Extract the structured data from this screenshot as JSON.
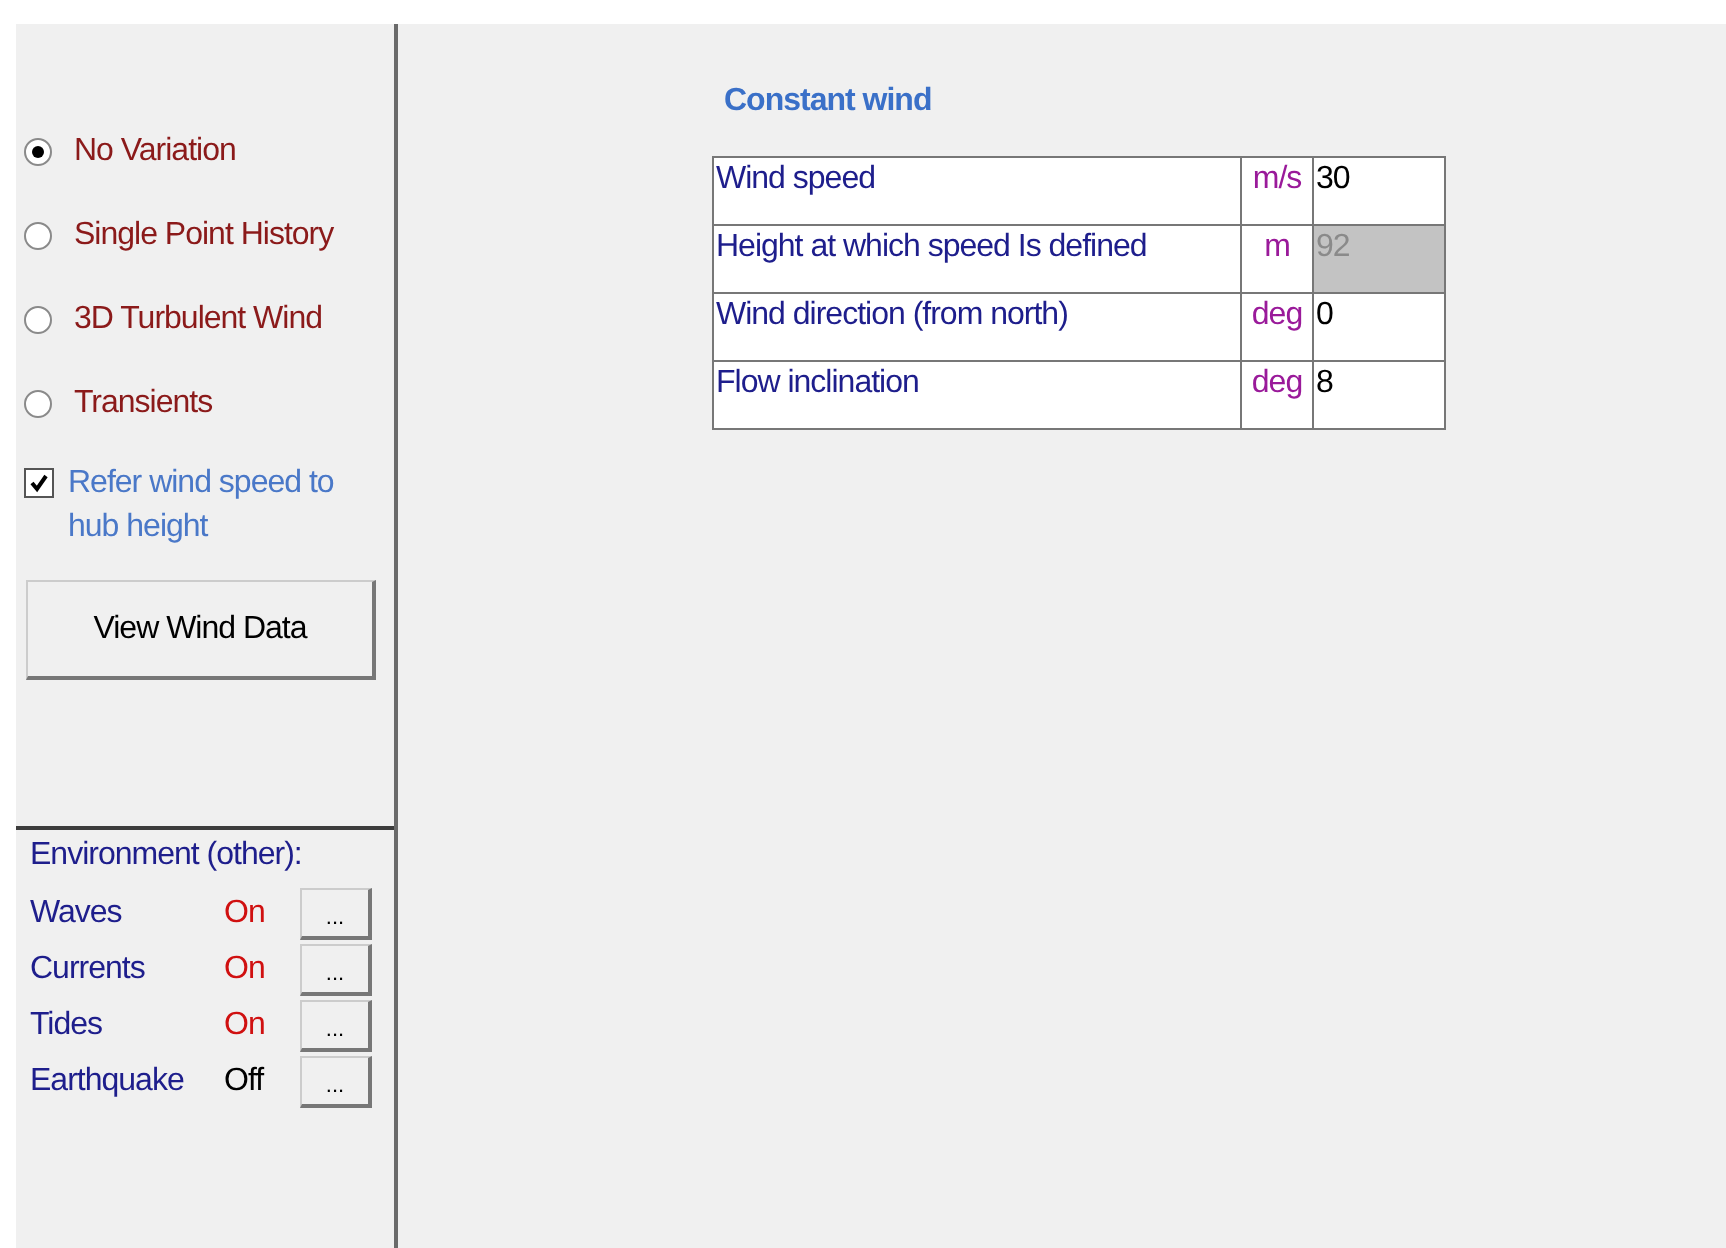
{
  "wind_types": [
    {
      "label": "No Variation",
      "selected": true
    },
    {
      "label": "Single Point History",
      "selected": false
    },
    {
      "label": "3D Turbulent Wind",
      "selected": false
    },
    {
      "label": "Transients",
      "selected": false
    }
  ],
  "refer_hub": {
    "label": "Refer wind speed to hub height",
    "checked": true
  },
  "view_button": "View Wind Data",
  "environment": {
    "title": "Environment (other):",
    "items": [
      {
        "name": "Waves",
        "status": "On",
        "on": true,
        "button": "..."
      },
      {
        "name": "Currents",
        "status": "On",
        "on": true,
        "button": "..."
      },
      {
        "name": "Tides",
        "status": "On",
        "on": true,
        "button": "..."
      },
      {
        "name": "Earthquake",
        "status": "Off",
        "on": false,
        "button": "..."
      }
    ]
  },
  "constant_wind": {
    "title": "Constant wind",
    "rows": [
      {
        "label": "Wind speed",
        "unit": "m/s",
        "value": "30",
        "disabled": false
      },
      {
        "label": "Height at which speed Is defined",
        "unit": "m",
        "value": "92",
        "disabled": true
      },
      {
        "label": "Wind direction (from north)",
        "unit": "deg",
        "value": "0",
        "disabled": false
      },
      {
        "label": "Flow inclination",
        "unit": "deg",
        "value": "8",
        "disabled": false
      }
    ]
  }
}
